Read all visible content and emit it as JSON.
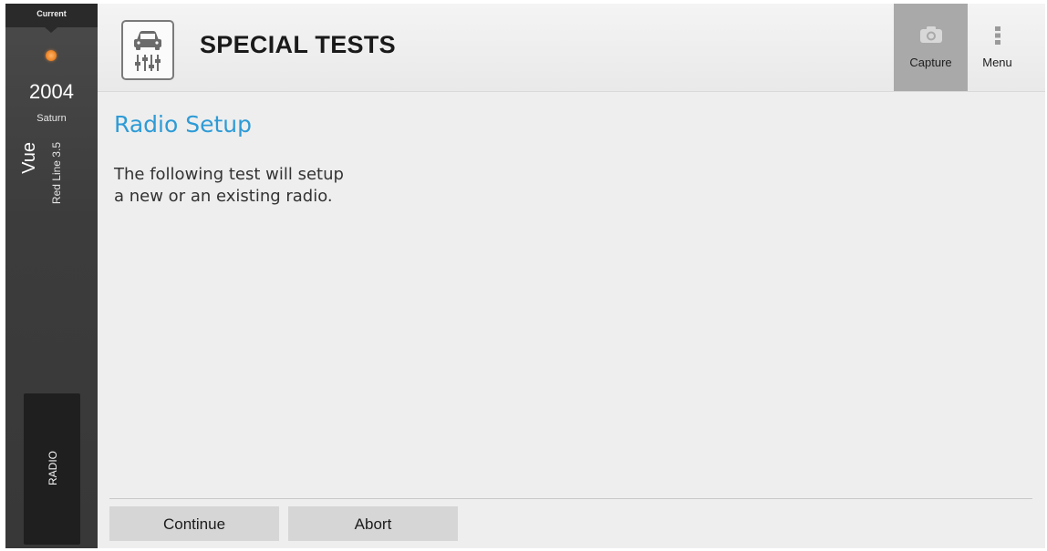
{
  "sidebar": {
    "current_label": "Current",
    "year": "2004",
    "make": "Saturn",
    "model": "Vue",
    "engine": "Red Line 3.5",
    "tab_label": "RADIO"
  },
  "header": {
    "title": "SPECIAL TESTS",
    "icon": "vehicle-test-icon",
    "capture_label": "Capture",
    "capture_icon": "camera-icon",
    "menu_label": "Menu",
    "menu_icon": "overflow-dots-icon"
  },
  "content": {
    "title": "Radio Setup",
    "description_line1": "The following test will setup",
    "description_line2": "a new or an existing radio."
  },
  "footer": {
    "continue_label": "Continue",
    "abort_label": "Abort"
  },
  "colors": {
    "accent": "#2e9bd6",
    "status_dot": "#f08a2c",
    "sidebar_bg": "#3c3c3c",
    "capture_active_bg": "#a9a9a9"
  }
}
